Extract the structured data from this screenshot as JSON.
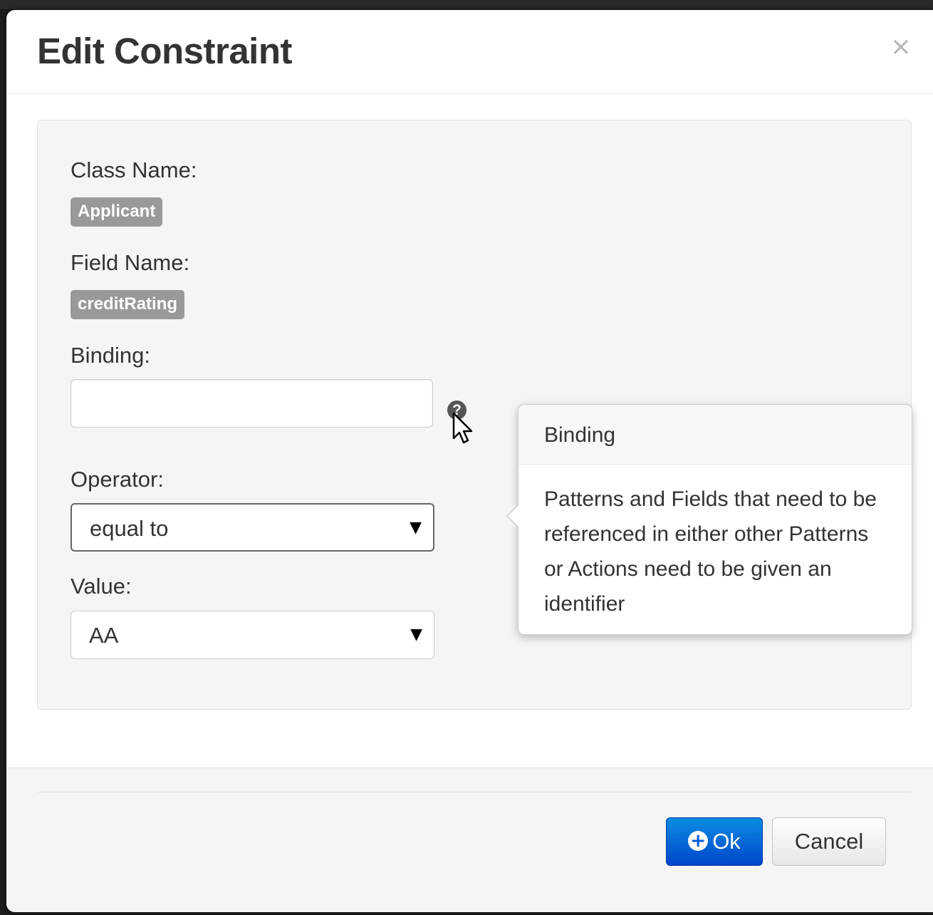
{
  "dialog": {
    "title": "Edit Constraint",
    "close_glyph": "×"
  },
  "form": {
    "class_name_label": "Class Name:",
    "class_name_value": "Applicant",
    "field_name_label": "Field Name:",
    "field_name_value": "creditRating",
    "binding_label": "Binding:",
    "binding_value": "",
    "help_glyph": "?",
    "operator_label": "Operator:",
    "operator_value": "equal to",
    "value_label": "Value:",
    "value_value": "AA",
    "caret_glyph": "▼"
  },
  "popover": {
    "title": "Binding",
    "content": "Patterns and Fields that need to be referenced in either other Patterns or Actions need to be given an identifier"
  },
  "footer": {
    "ok_label": "Ok",
    "ok_icon": "plus-circle-icon",
    "cancel_label": "Cancel"
  },
  "colors": {
    "primary_button": "#0058d8",
    "badge": "#999999",
    "well_background": "#f5f5f5"
  }
}
